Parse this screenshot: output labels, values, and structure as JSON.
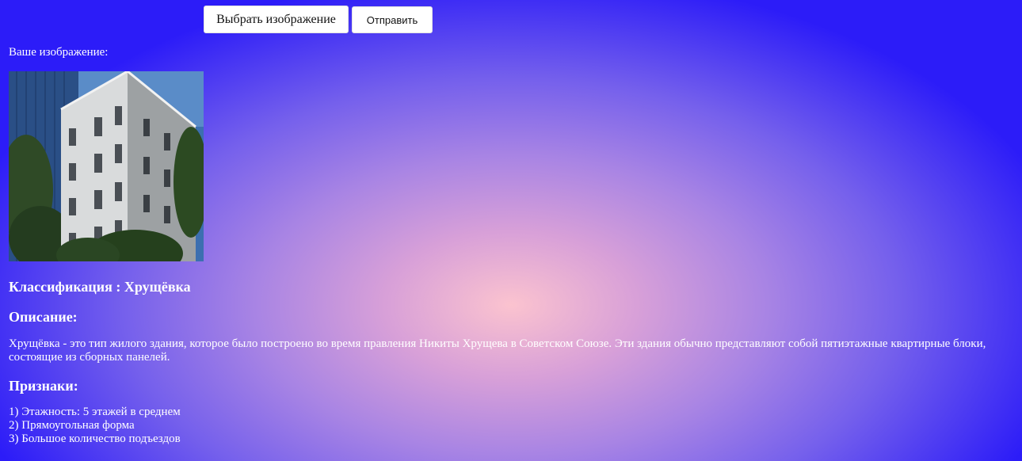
{
  "toolbar": {
    "choose_label": "Выбрать изображение",
    "send_label": "Отправить"
  },
  "image_caption": "Ваше изображение:",
  "classification": {
    "label": "Классификация",
    "separator": " : ",
    "value": "Хрущёвка"
  },
  "description": {
    "heading": "Описание:",
    "text": "Хрущёвка - это тип жилого здания, которое было построено во время правления Никиты Хрущева в Советском Союзе. Эти здания обычно представляют собой пятиэтажные квартирные блоки, состоящие из сборных панелей."
  },
  "features": {
    "heading": "Признаки:",
    "items": [
      "1) Этажность: 5 этажей в среднем",
      "2) Прямоугольная форма",
      "3) Большое количество подъездов"
    ]
  }
}
